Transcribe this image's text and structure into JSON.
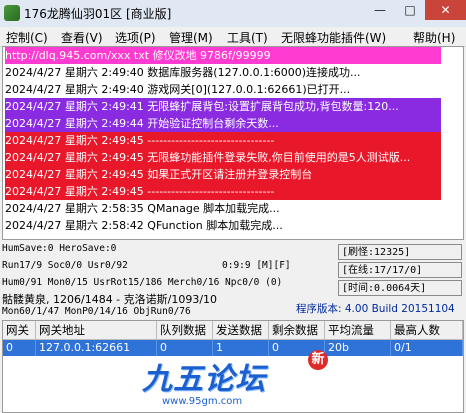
{
  "window": {
    "title": "176龙腾仙羽01区 [商业版]",
    "min_icon": "—",
    "max_icon": "□",
    "close_icon": "✕"
  },
  "menu": {
    "items": [
      "控制(C)",
      "查看(V)",
      "选项(P)",
      "管理(M)",
      "工具(T)",
      "无限蜂功能插件(W)",
      "帮助(H)"
    ]
  },
  "log": {
    "lines": [
      {
        "text": "http://dlq.945.com/xxx txt 修仪改地 9786f/99999",
        "bg": "#ff3bd1",
        "color": "#ffffff"
      },
      {
        "text": "2024/4/27  星期六  2:49:40  数据库服务器(127.0.0.1:6000)连接成功...",
        "bg": "#ffffff",
        "color": "#000000"
      },
      {
        "text": "2024/4/27  星期六  2:49:40  游戏网关[0](127.0.0.1:62661)已打开...",
        "bg": "#ffffff",
        "color": "#000000"
      },
      {
        "text": "2024/4/27  星期六  2:49:41  无限蜂扩展背包:设置扩展背包成功,背包数量:120...",
        "bg": "#8a2be2",
        "color": "#ffffff"
      },
      {
        "text": "2024/4/27  星期六  2:49:44  开始验证控制台剩余天数...",
        "bg": "#8a2be2",
        "color": "#ffffff"
      },
      {
        "text": "2024/4/27  星期六  2:49:45  --------------------------------",
        "bg": "#e8182a",
        "color": "#ffffff"
      },
      {
        "text": "2024/4/27  星期六  2:49:45  无限蜂功能插件登录失败,你目前使用的是5人测试版...",
        "bg": "#e8182a",
        "color": "#ffffff"
      },
      {
        "text": "2024/4/27  星期六  2:49:45  如果正式开区请注册并登录控制台",
        "bg": "#e8182a",
        "color": "#ffffff"
      },
      {
        "text": "2024/4/27  星期六  2:49:45  --------------------------------",
        "bg": "#e8182a",
        "color": "#ffffff"
      },
      {
        "text": "2024/4/27  星期六  2:58:35  QManage 脚本加载完成...",
        "bg": "#ffffff",
        "color": "#000000"
      },
      {
        "text": "2024/4/27  星期六  2:58:42  QFunction 脚本加载完成...",
        "bg": "#ffffff",
        "color": "#000000"
      }
    ]
  },
  "stats": {
    "line1": "HumSave:0  HeroSave:0",
    "line2": "Run17/9  Soc0/0  Usr0/92",
    "line2b": "0:9:9 [M][F]",
    "line3": "Hum0/91  Mon0/15  UsrRot15/186  Merch0/16  Npc0/0  (0)",
    "line4": "骷髅黄泉, 1206/1484 - 克洛诺斯/1093/10",
    "line5": "Mon60/1/47  MonP0/14/16  ObjRun0/76",
    "refresh": "[刷怪:12325]",
    "online": "[在线:17/17/0]",
    "time": "[时间:0.0064天]",
    "version": "程序版本: 4.00 Build 20151104"
  },
  "gateway": {
    "headers": [
      "网关",
      "网关地址",
      "队列数据",
      "发送数据",
      "剩余数据",
      "平均流量",
      "最高人数"
    ],
    "row": [
      "0",
      "127.0.0.1:62661",
      "0",
      "1",
      "0",
      "20b",
      "0/1"
    ]
  },
  "watermark": {
    "title": "九五论坛",
    "badge": "新",
    "url": "www.95gm.com"
  }
}
